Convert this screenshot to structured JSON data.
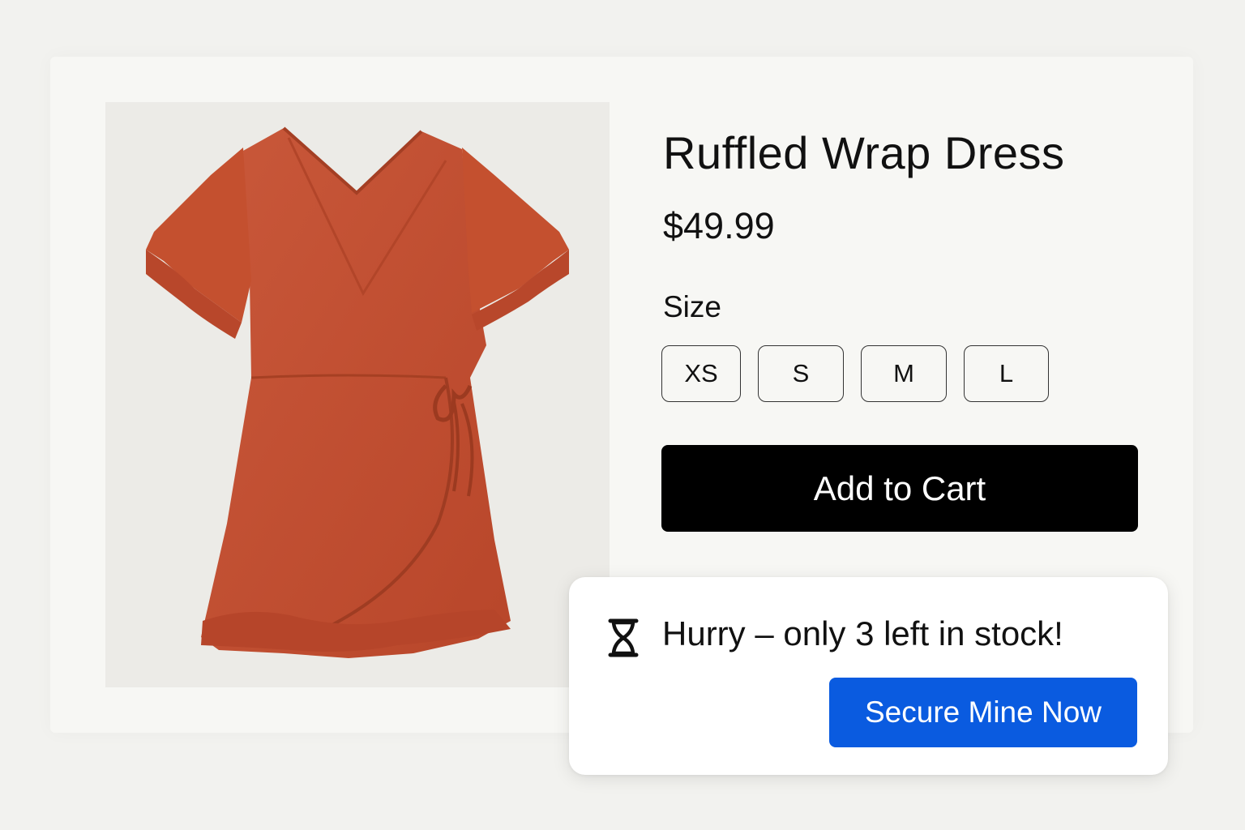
{
  "product": {
    "title": "Ruffled Wrap Dress",
    "price": "$49.99",
    "image_alt": "Ruffled wrap dress in rust orange",
    "dress_color": "#c2502f",
    "size_label": "Size",
    "sizes": [
      "XS",
      "S",
      "M",
      "L"
    ],
    "add_to_cart_label": "Add to Cart"
  },
  "urgency_popup": {
    "icon": "hourglass-icon",
    "message": "Hurry – only 3 left in stock!",
    "cta_label": "Secure Mine Now",
    "cta_color": "#0a5be0"
  }
}
